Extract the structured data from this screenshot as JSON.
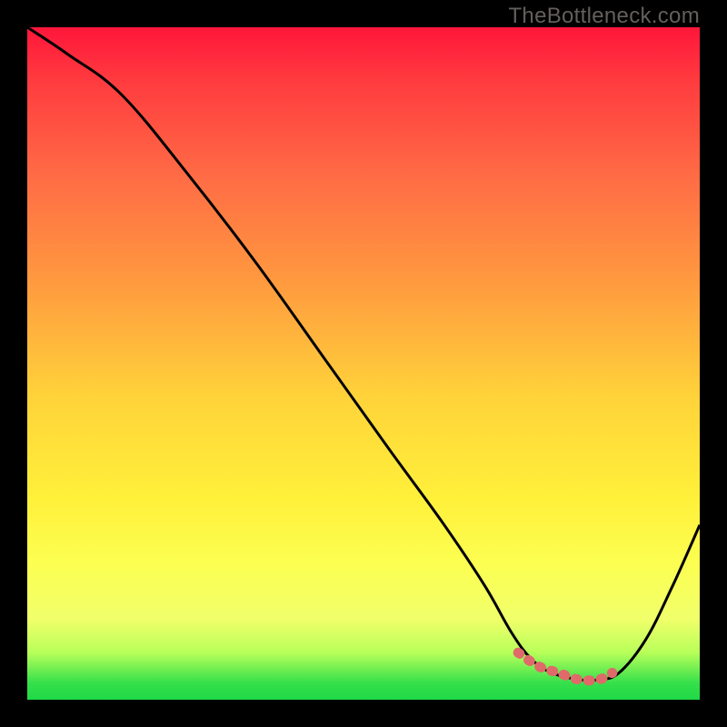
{
  "watermark": "TheBottleneck.com",
  "chart_data": {
    "type": "line",
    "title": "",
    "xlabel": "",
    "ylabel": "",
    "xlim": [
      0,
      100
    ],
    "ylim": [
      0,
      100
    ],
    "series": [
      {
        "name": "curve",
        "x": [
          0,
          6,
          14,
          24,
          34,
          44,
          54,
          62,
          68,
          72,
          75,
          78,
          82,
          85,
          88,
          92,
          96,
          100
        ],
        "values": [
          100,
          96,
          90,
          78,
          65,
          51,
          37,
          26,
          17,
          10,
          6,
          4,
          3,
          3,
          4,
          9,
          17,
          26
        ]
      },
      {
        "name": "highlight-band",
        "x": [
          73,
          76,
          79,
          82,
          85,
          87
        ],
        "values": [
          7,
          5,
          4,
          3,
          3,
          4
        ]
      }
    ],
    "colors": {
      "curve": "#000000",
      "highlight": "#e06a6a",
      "gradient_top": "#ff163a",
      "gradient_bottom": "#1fd847"
    }
  }
}
